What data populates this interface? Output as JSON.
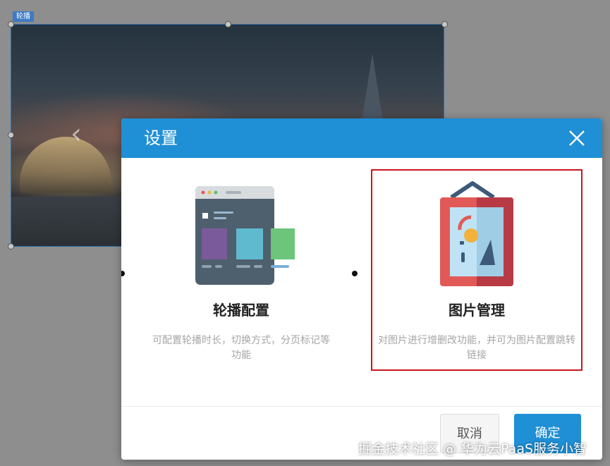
{
  "component_tag": "轮播",
  "dialog": {
    "title": "设置",
    "options": [
      {
        "title": "轮播配置",
        "description": "可配置轮播时长，切换方式，分页标记等功能"
      },
      {
        "title": "图片管理",
        "description": "对图片进行增删改功能，并可为图片配置跳转链接"
      }
    ],
    "cancel_label": "取消",
    "ok_label": "确定"
  },
  "watermark": "掘金技术社区 @ 华为云PaaS服务小智",
  "colors": {
    "header": "#1f8fd6",
    "selected_border": "#c9151e",
    "overlay": "#8e8e8e"
  }
}
